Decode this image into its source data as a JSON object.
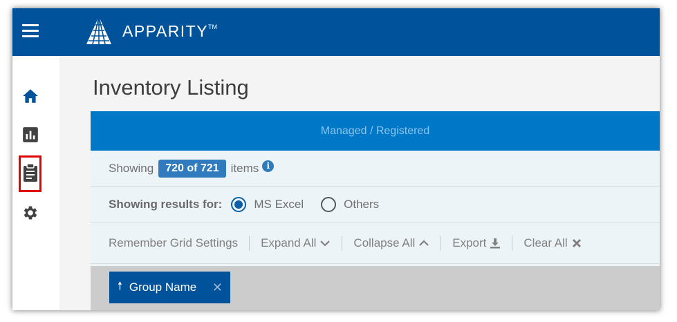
{
  "brand": {
    "name": "APPARITY",
    "trademark": "TM",
    "header_color": "#00529b"
  },
  "sidebar": {
    "items": [
      {
        "icon": "home-icon"
      },
      {
        "icon": "bar-chart-icon"
      },
      {
        "icon": "clipboard-icon",
        "highlighted": true
      },
      {
        "icon": "gear-icon"
      }
    ],
    "highlight_color": "#e00000"
  },
  "page": {
    "title": "Inventory Listing"
  },
  "tabs": {
    "active": "Managed / Registered"
  },
  "summary": {
    "prefix": "Showing",
    "count": "720 of 721",
    "suffix": "items"
  },
  "filter": {
    "label": "Showing results for:",
    "options": [
      {
        "label": "MS Excel",
        "checked": true
      },
      {
        "label": "Others",
        "checked": false
      }
    ]
  },
  "toolbar": {
    "remember": "Remember Grid Settings",
    "expand": "Expand All",
    "collapse": "Collapse All",
    "export": "Export",
    "clear": "Clear All"
  },
  "grouping": {
    "chip_label": "Group Name",
    "sort": "ascending"
  }
}
